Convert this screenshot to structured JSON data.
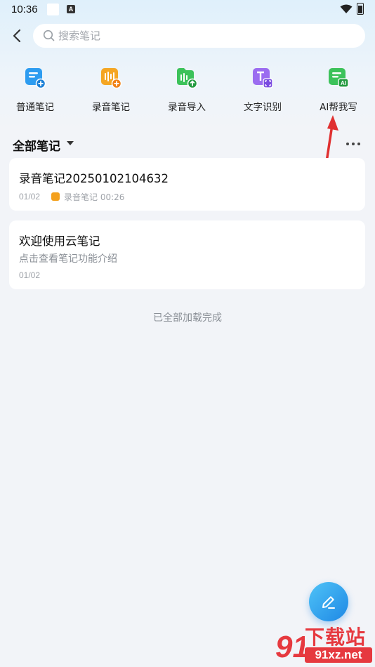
{
  "status_bar": {
    "time": "10:36",
    "notification_icon": "A"
  },
  "search": {
    "placeholder": "搜索笔记",
    "value": ""
  },
  "quick_actions": [
    {
      "label": "普通笔记",
      "icon": "note-add-icon",
      "color": "#2d9cf0"
    },
    {
      "label": "录音笔记",
      "icon": "voice-note-add-icon",
      "color": "#f5a623"
    },
    {
      "label": "录音导入",
      "icon": "audio-import-icon",
      "color": "#3cc25a"
    },
    {
      "label": "文字识别",
      "icon": "text-recognition-icon",
      "color": "#9b6cf0"
    },
    {
      "label": "AI帮我写",
      "icon": "ai-write-icon",
      "color": "#3cc25a"
    }
  ],
  "section": {
    "title": "全部笔记"
  },
  "notes": [
    {
      "title": "录音笔记20250102104632",
      "date": "01/02",
      "recording": "录音笔记 00:26"
    },
    {
      "title": "欢迎使用云笔记",
      "desc": "点击查看笔记功能介绍",
      "date": "01/02"
    }
  ],
  "list_footer": "已全部加载完成",
  "watermark": {
    "title": "下载站",
    "url": "91xz.net",
    "logo_text": "91"
  },
  "colors": {
    "accent": "#1e88e5",
    "annotation": "#e03030",
    "background": "#f2f4f8"
  }
}
